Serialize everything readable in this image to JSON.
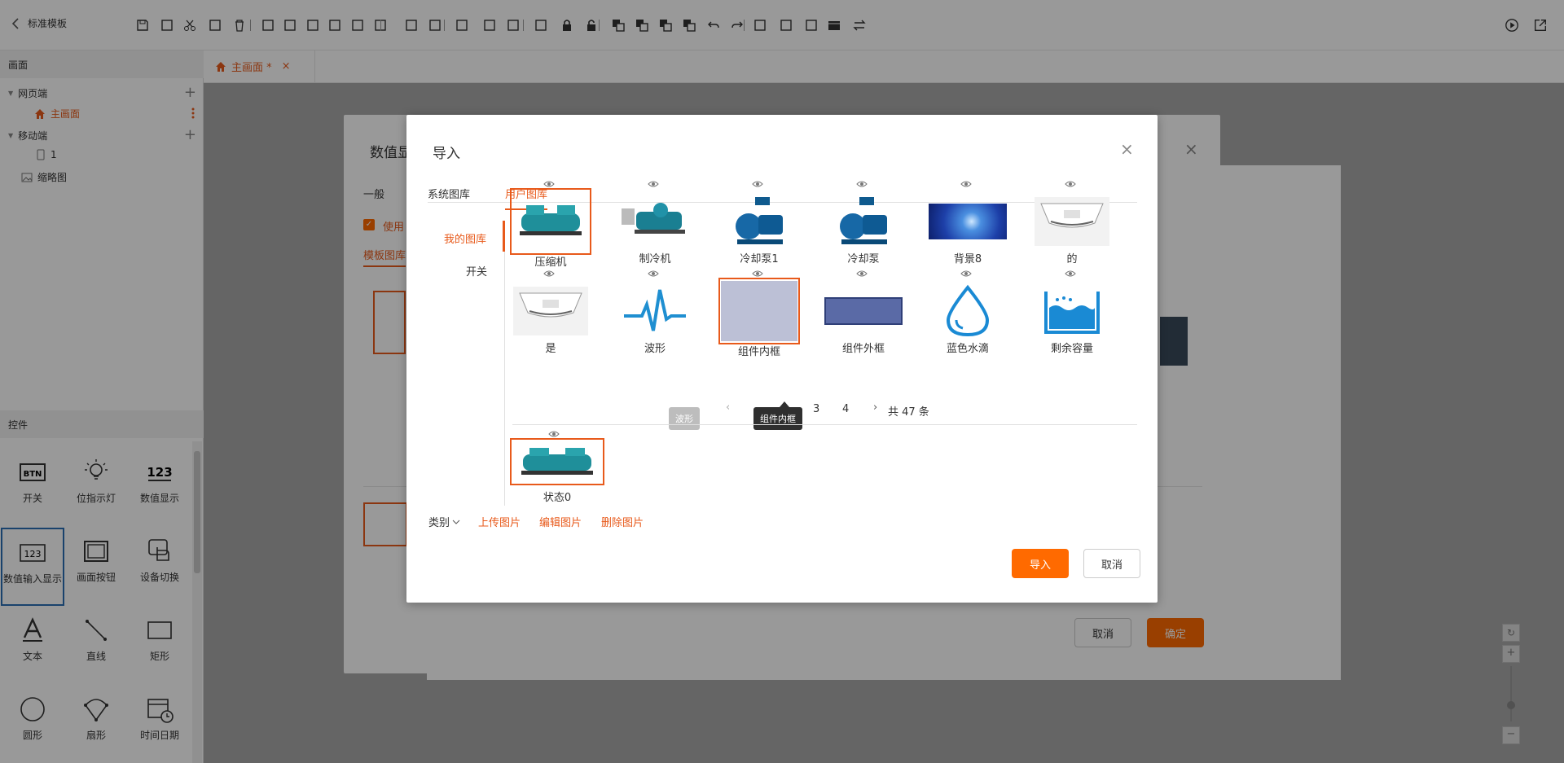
{
  "app": {
    "back_label": "标准模板"
  },
  "left_panel": {
    "screen_header": "画面",
    "tree": {
      "web_label": "网页端",
      "main_screen": "主画面",
      "mobile_label": "移动端",
      "mobile_item": "1",
      "thumbnail": "缩略图"
    },
    "controls_header": "控件",
    "controls": [
      "开关",
      "位指示灯",
      "数值显示",
      "数值输入显示",
      "画面按钮",
      "设备切换",
      "文本",
      "直线",
      "矩形",
      "圆形",
      "扇形",
      "时间日期"
    ]
  },
  "tab_bar": {
    "active_tab": "主画面 *",
    "close": "×"
  },
  "bg_dialog": {
    "title": "数值显",
    "tab_general": "一般",
    "checkbox_label": "使用",
    "template_label": "模板图库",
    "cancel": "取消",
    "confirm": "确定",
    "close": "×"
  },
  "import_dialog": {
    "title": "导入",
    "close": "×",
    "tabs": [
      "系统图库",
      "用户图库"
    ],
    "active_tab": 1,
    "categories": [
      "我的图库",
      "开关"
    ],
    "active_category": 0,
    "items": [
      {
        "label": "压缩机",
        "icon": "compressor",
        "selected": true
      },
      {
        "label": "制冷机",
        "icon": "chiller"
      },
      {
        "label": "冷却泵1",
        "icon": "pump"
      },
      {
        "label": "冷却泵",
        "icon": "pump"
      },
      {
        "label": "背景8",
        "icon": "blue-background"
      },
      {
        "label": "的",
        "icon": "ceiling-ac"
      },
      {
        "label": "是",
        "icon": "ceiling-ac"
      },
      {
        "label": "波形",
        "icon": "waveform"
      },
      {
        "label": "组件内框",
        "icon": "gray-rect",
        "selected": true
      },
      {
        "label": "组件外框",
        "icon": "navy-rect"
      },
      {
        "label": "蓝色水滴",
        "icon": "water-drop"
      },
      {
        "label": "剩余容量",
        "icon": "tank-level"
      }
    ],
    "pagination": {
      "prev": "‹",
      "pages": [
        "3",
        "4"
      ],
      "next": "›",
      "total": "共 47 条"
    },
    "tooltips": {
      "wave": "波形",
      "inner": "组件内框"
    },
    "bottom_item": {
      "label": "状态0",
      "icon": "compressor"
    },
    "actions": {
      "category": "类别",
      "upload": "上传图片",
      "edit": "编辑图片",
      "delete": "删除图片"
    },
    "footer": {
      "import": "导入",
      "cancel": "取消"
    }
  },
  "colors": {
    "accent": "#ff6a00",
    "accent_text": "#e85a1b",
    "dialog_bg": "#ffffff",
    "canvas_bg": "#a8a8a8"
  }
}
